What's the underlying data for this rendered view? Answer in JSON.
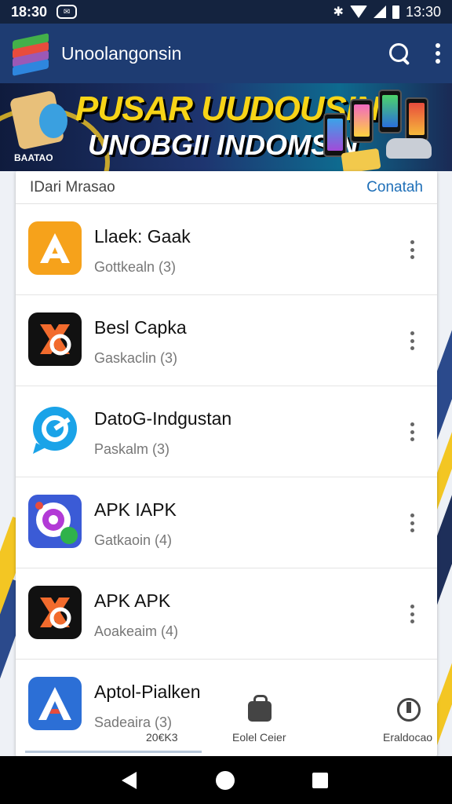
{
  "status_bar": {
    "time_left": "18:30",
    "time_right": "13:30",
    "notif": "✉"
  },
  "app_bar": {
    "title": "Unoolangonsin"
  },
  "banner": {
    "line1": "PUSAR UUDOUSIN",
    "line2": "UNOBGII INDOMSIN",
    "corner": "BAATAO"
  },
  "list": {
    "header_title": "IDari Mrasao",
    "header_action": "Conatah",
    "apps": [
      {
        "name": "Llaek: Gaak",
        "sub": "Gottkealn (3)"
      },
      {
        "name": "Besl Capka",
        "sub": "Gaskaclin (3)"
      },
      {
        "name": "DatoG-Indgustan",
        "sub": "Paskalm (3)"
      },
      {
        "name": "APK IAPK",
        "sub": "Gatkaoin (4)"
      },
      {
        "name": "APK APK",
        "sub": "Aoakeaim (4)"
      },
      {
        "name": "Aptol-Pialken",
        "sub": "Sadeaira (3)"
      }
    ]
  },
  "bottom_nav": {
    "left_label": "20€K3",
    "center_label": "Eolel Ceier",
    "right_label": "Eraldocao"
  },
  "colors": {
    "app_bar": "#1e3c72",
    "accent": "#1e6fb8",
    "banner_yellow": "#f7d417"
  }
}
